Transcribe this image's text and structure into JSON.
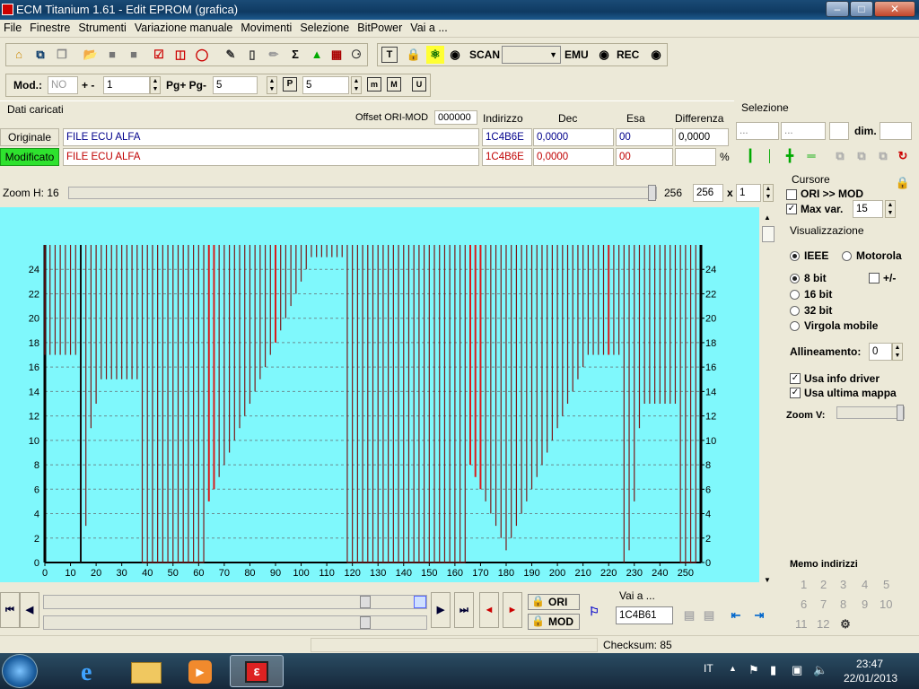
{
  "window": {
    "title": "ECM Titanium 1.61 - Edit EPROM (grafica)",
    "min_label": "–",
    "max_label": "□",
    "close_label": "✕"
  },
  "menu": [
    "File",
    "Finestre",
    "Strumenti",
    "Variazione manuale",
    "Movimenti",
    "Selezione",
    "BitPower",
    "Vai a ..."
  ],
  "toolbar": {
    "scan_label": "SCAN",
    "emu_label": "EMU",
    "rec_label": "REC"
  },
  "toolbar2": {
    "mod_label": "Mod.:",
    "mod_value": "NO",
    "step_label": "+ -",
    "step_value": "1",
    "pg_label": "Pg+ Pg-",
    "pg_value": "5",
    "p_value": "5"
  },
  "dati": {
    "heading": "Dati caricati",
    "offset_label": "Offset ORI-MOD",
    "offset_value": "000000",
    "col_indirizzo": "Indirizzo",
    "col_dec": "Dec",
    "col_esa": "Esa",
    "col_diff": "Differenza",
    "originale_label": "Originale",
    "originale_file": "FILE ECU ALFA",
    "originale_addr": "1C4B6E",
    "originale_dec": "0,0000",
    "originale_esa": "00",
    "originale_diff": "0,0000",
    "modificato_label": "Modificato",
    "modificato_file": "FILE ECU ALFA",
    "modificato_addr": "1C4B6E",
    "modificato_dec": "0,0000",
    "modificato_esa": "00",
    "percent": "%"
  },
  "selezione": {
    "heading": "Selezione",
    "f1": "...",
    "f2": "...",
    "dim_label": "dim."
  },
  "zoom": {
    "label": "Zoom H: 16",
    "value_a": "256",
    "value_b": "256",
    "x_label": "x",
    "value_c": "1",
    "zoom_v_label": "Zoom V:"
  },
  "cursore": {
    "heading": "Cursore",
    "ori_mod_label": "ORI >> MOD",
    "max_var_label": "Max var.",
    "max_var_value": "15"
  },
  "visualizzazione": {
    "heading": "Visualizzazione",
    "ieee": "IEEE",
    "motorola": "Motorola",
    "bit8": "8 bit",
    "bit16": "16 bit",
    "bit32": "32 bit",
    "virgola": "Virgola mobile",
    "plusminus": "+/-",
    "allineamento_label": "Allineamento:",
    "allineamento_value": "0",
    "usa_info_driver": "Usa info driver",
    "usa_ultima_mappa": "Usa ultima mappa"
  },
  "memo": {
    "heading": "Memo indirizzi",
    "numbers": [
      "1",
      "2",
      "3",
      "4",
      "5",
      "6",
      "7",
      "8",
      "9",
      "10",
      "11",
      "12"
    ]
  },
  "nav": {
    "ori_label": "ORI",
    "mod_label": "MOD",
    "vai_label": "Vai a ...",
    "vai_value": "1C4B61"
  },
  "status": {
    "checksum": "Checksum: 85"
  },
  "taskbar": {
    "lang": "IT",
    "time": "23:47",
    "date": "22/01/2013"
  },
  "colors": {
    "chart_bg": "#7ff8fc",
    "line_ori": "#7a1a1a",
    "line_mod": "#d81c1c",
    "modificato_bg": "#2ee22e"
  },
  "chart_data": {
    "type": "bar",
    "xlim": [
      0,
      256
    ],
    "ylim": [
      0,
      26
    ],
    "xticks": [
      0,
      10,
      20,
      30,
      40,
      50,
      60,
      70,
      80,
      90,
      100,
      110,
      120,
      130,
      140,
      150,
      160,
      170,
      180,
      190,
      200,
      210,
      220,
      230,
      240,
      250
    ],
    "yticks": [
      0,
      2,
      4,
      6,
      8,
      10,
      12,
      14,
      16,
      18,
      20,
      22,
      24
    ],
    "grid": true,
    "x": [
      0,
      2,
      4,
      6,
      8,
      10,
      12,
      14,
      16,
      18,
      20,
      22,
      24,
      26,
      28,
      30,
      32,
      34,
      36,
      38,
      40,
      42,
      44,
      46,
      48,
      50,
      52,
      54,
      56,
      58,
      60,
      62,
      64,
      66,
      68,
      70,
      72,
      74,
      76,
      78,
      80,
      82,
      84,
      86,
      88,
      90,
      92,
      94,
      96,
      98,
      100,
      102,
      104,
      106,
      108,
      110,
      112,
      114,
      116,
      118,
      120,
      122,
      124,
      126,
      128,
      130,
      132,
      134,
      136,
      138,
      140,
      142,
      144,
      146,
      148,
      150,
      152,
      154,
      156,
      158,
      160,
      162,
      164,
      166,
      168,
      170,
      172,
      174,
      176,
      178,
      180,
      182,
      184,
      186,
      188,
      190,
      192,
      194,
      196,
      198,
      200,
      202,
      204,
      206,
      208,
      210,
      212,
      214,
      216,
      218,
      220,
      222,
      224,
      226,
      228,
      230,
      232,
      234,
      236,
      238,
      240,
      242,
      244,
      246,
      248,
      250,
      252,
      254
    ],
    "values": [
      17,
      17,
      17,
      17,
      17,
      17,
      17,
      0,
      3,
      11,
      13,
      15,
      15,
      15,
      15,
      15,
      15,
      15,
      15,
      0,
      0,
      0,
      0,
      0,
      0,
      0,
      0,
      0,
      0,
      0,
      0,
      0,
      5,
      6,
      7,
      8,
      9,
      10,
      11,
      12,
      13,
      14,
      15,
      16,
      17,
      18,
      19,
      20,
      21,
      22,
      23,
      24,
      25,
      25,
      25,
      25,
      25,
      25,
      25,
      0,
      0,
      0,
      0,
      0,
      0,
      0,
      0,
      0,
      0,
      0,
      0,
      0,
      0,
      0,
      0,
      0,
      0,
      0,
      0,
      0,
      0,
      0,
      0,
      8,
      7,
      6,
      5,
      4,
      3,
      2,
      1,
      2,
      3,
      4,
      5,
      6,
      7,
      8,
      9,
      10,
      11,
      12,
      13,
      14,
      15,
      16,
      17,
      17,
      17,
      17,
      17,
      17,
      17,
      0,
      1,
      5,
      11,
      13,
      13,
      13,
      13,
      13,
      13,
      13,
      0,
      0,
      0,
      0,
      0,
      0,
      0,
      0
    ],
    "highlighted_x": [
      14,
      64,
      66,
      90,
      115,
      166,
      168,
      170,
      220
    ],
    "highlighted_x_note": "red (modified) bars"
  }
}
